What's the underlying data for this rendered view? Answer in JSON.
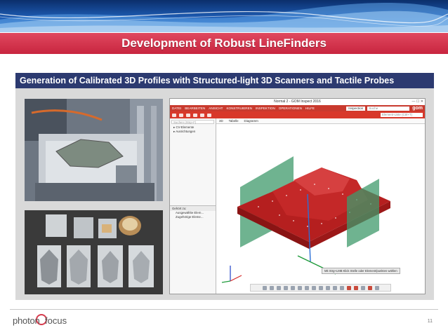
{
  "slide": {
    "title": "Development of Robust LineFinders",
    "subtitle": "Generation of Calibrated 3D Profiles with Structured-light 3D Scanners and Tactile Probes",
    "page_number": "11"
  },
  "footer": {
    "logo_part1": "photon",
    "logo_part2": "focus"
  },
  "gom_window": {
    "title": "Normal 2 - GOM Inspect 2016",
    "menu": [
      "DATEI",
      "BEARBEITEN",
      "ANSICHT",
      "KONSTRUIEREN",
      "INSPEKTION",
      "OPERATIONEN",
      "HILFE"
    ],
    "inspection_label": "Inspection",
    "search_placeholder": "Suche",
    "logo": "gom",
    "toolbar_select": "Element-Liste (Ctrl+T)",
    "left_search_placeholder": "Suchen (Strg+F)",
    "tree_items": [
      "CV-Elemente",
      "Ausrichtungen"
    ],
    "lower_header": "Gehört zu:",
    "lower_items": [
      "Ausgewählte Elem...",
      "Zugehörige Eleme..."
    ],
    "tabs": [
      "3D",
      "Tabelle",
      "Diagramm"
    ],
    "status_tip": "Mit Strg+LMB Klick Stelle oder Element/punkten wählen"
  },
  "colors": {
    "title_bar": "#c8253f",
    "subtitle_bar": "#2c3a70",
    "gom_menu": "#c93a2e",
    "model_red": "#b51f1f",
    "plane_green": "#3f9a6b"
  }
}
